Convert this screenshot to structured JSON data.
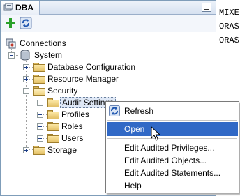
{
  "panel": {
    "tab_title": "DBA"
  },
  "tree": {
    "connections": "Connections",
    "system": "System",
    "database_configuration": "Database Configuration",
    "resource_manager": "Resource Manager",
    "security": "Security",
    "audit_settings": "Audit Settings",
    "profiles": "Profiles",
    "roles": "Roles",
    "users": "Users",
    "storage": "Storage"
  },
  "right_pane": {
    "lines": [
      "MIXE",
      "ORA$",
      "ORA$"
    ]
  },
  "context_menu": {
    "refresh": "Refresh",
    "open": "Open",
    "edit_privileges": "Edit Audited Privileges...",
    "edit_objects": "Edit Audited Objects...",
    "edit_statements": "Edit Audited Statements...",
    "help": "Help"
  },
  "colors": {
    "highlight": "#3169c6",
    "folder": "#e3c066",
    "add_icon": "#2aa12a"
  }
}
